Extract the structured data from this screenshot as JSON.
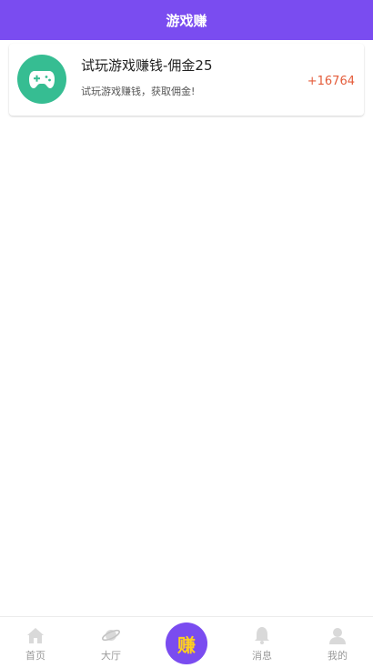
{
  "header": {
    "title": "游戏赚"
  },
  "tasks": [
    {
      "title": "试玩游戏赚钱-佣金25",
      "description": "试玩游戏赚钱，获取佣金!",
      "reward": "+16764",
      "icon": "gamepad-icon",
      "icon_bg": "#36bd92"
    }
  ],
  "tabbar": {
    "items": [
      {
        "label": "首页",
        "icon": "home-icon"
      },
      {
        "label": "大厅",
        "icon": "planet-icon"
      },
      {
        "label": "消息",
        "icon": "bell-icon"
      },
      {
        "label": "我的",
        "icon": "user-icon"
      }
    ],
    "center": {
      "label": "赚",
      "bg": "#7a4cf0",
      "color": "#ffd01e"
    }
  },
  "colors": {
    "accent": "#7a4cf0",
    "reward": "#e45c3a",
    "tab_text": "#9a9a9a"
  }
}
